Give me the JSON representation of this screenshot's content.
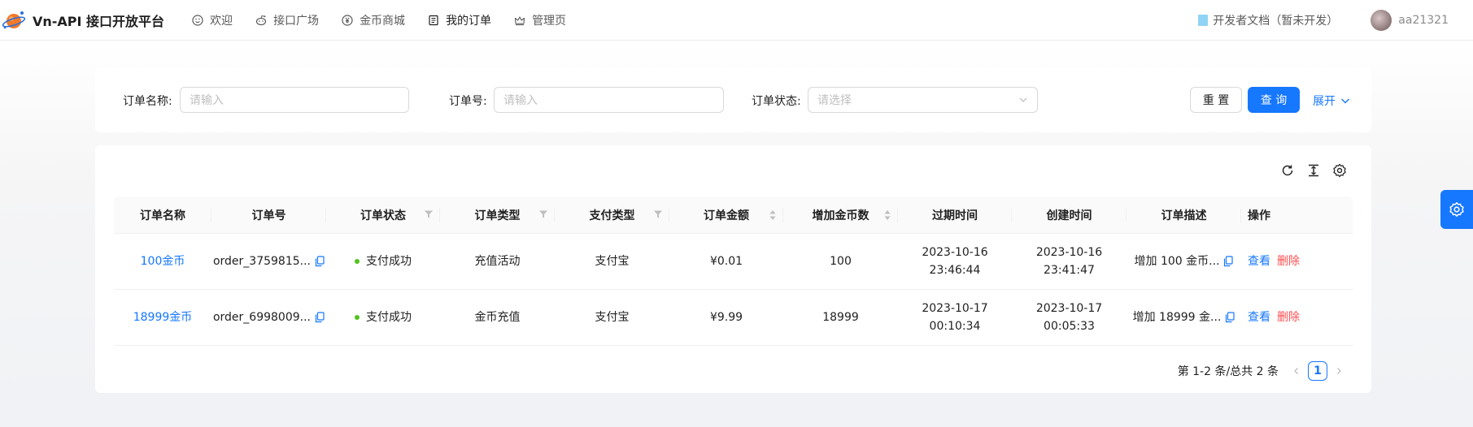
{
  "header": {
    "title": "Vn-API 接口开放平台",
    "nav": [
      {
        "label": "欢迎",
        "icon": "smile-icon"
      },
      {
        "label": "接口广场",
        "icon": "reddit-icon"
      },
      {
        "label": "金币商城",
        "icon": "yuan-circle-icon"
      },
      {
        "label": "我的订单",
        "icon": "order-list-icon"
      },
      {
        "label": "管理页",
        "icon": "crown-icon"
      }
    ],
    "active_nav": "我的订单",
    "doc_link": "开发者文档（暂未开发）",
    "username": "aa21321"
  },
  "search": {
    "fields": [
      {
        "label": "订单名称:",
        "placeholder": "请输入"
      },
      {
        "label": "订单号:",
        "placeholder": "请输入"
      },
      {
        "label": "订单状态:",
        "placeholder": "请选择"
      }
    ],
    "reset_label": "重 置",
    "query_label": "查 询",
    "expand_label": "展开"
  },
  "table": {
    "columns": [
      "订单名称",
      "订单号",
      "订单状态",
      "订单类型",
      "支付类型",
      "订单金额",
      "增加金币数",
      "过期时间",
      "创建时间",
      "订单描述",
      "操作"
    ],
    "rows": [
      {
        "name": "100金币",
        "order_no": "order_3759815...",
        "status": "支付成功",
        "type": "充值活动",
        "pay_type": "支付宝",
        "amount": "¥0.01",
        "coins": "100",
        "expire_date": "2023-10-16",
        "expire_time": "23:46:44",
        "create_date": "2023-10-16",
        "create_time": "23:41:47",
        "desc": "增加 100 金币...",
        "view": "查看",
        "delete": "删除"
      },
      {
        "name": "18999金币",
        "order_no": "order_6998009...",
        "status": "支付成功",
        "type": "金币充值",
        "pay_type": "支付宝",
        "amount": "¥9.99",
        "coins": "18999",
        "expire_date": "2023-10-17",
        "expire_time": "00:10:34",
        "create_date": "2023-10-17",
        "create_time": "00:05:33",
        "desc": "增加 18999 金...",
        "view": "查看",
        "delete": "删除"
      }
    ]
  },
  "pagination": {
    "summary": "第 1-2 条/总共 2 条",
    "current_page": "1"
  },
  "colors": {
    "primary": "#1677ff",
    "danger": "#ff4d4f",
    "success": "#52c41a"
  }
}
